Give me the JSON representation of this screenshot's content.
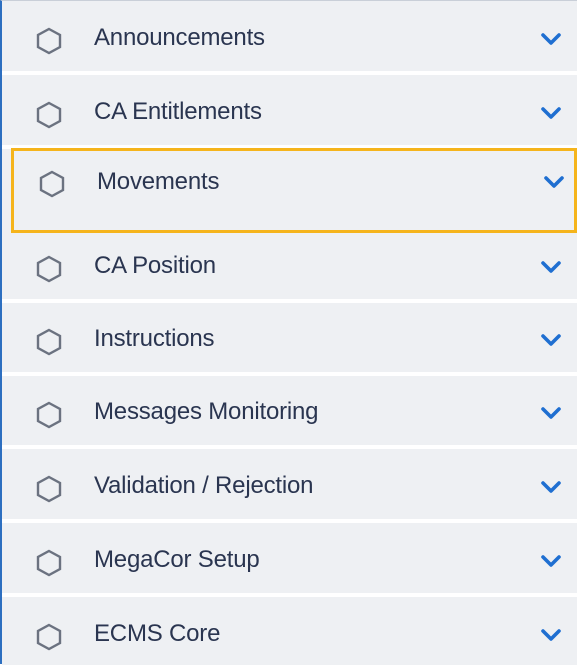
{
  "menu": {
    "items": [
      {
        "label": "Announcements",
        "icon": "hexagon-icon",
        "chevron": "chevron-down-icon"
      },
      {
        "label": "CA Entitlements",
        "icon": "hexagon-icon",
        "chevron": "chevron-down-icon"
      },
      {
        "label": "Movements",
        "icon": "hexagon-icon",
        "chevron": "chevron-down-icon",
        "selected": true
      },
      {
        "label": "CA Position",
        "icon": "hexagon-icon",
        "chevron": "chevron-down-icon"
      },
      {
        "label": "Instructions",
        "icon": "hexagon-icon",
        "chevron": "chevron-down-icon"
      },
      {
        "label": "Messages Monitoring",
        "icon": "hexagon-icon",
        "chevron": "chevron-down-icon"
      },
      {
        "label": "Validation / Rejection",
        "icon": "hexagon-icon",
        "chevron": "chevron-down-icon"
      },
      {
        "label": "MegaCor Setup",
        "icon": "hexagon-icon",
        "chevron": "chevron-down-icon"
      },
      {
        "label": "ECMS Core",
        "icon": "hexagon-icon",
        "chevron": "chevron-down-icon"
      }
    ]
  },
  "colors": {
    "text": "#2a3550",
    "chevron": "#1f6fd1",
    "highlight": "#f5b41b",
    "icon_stroke": "#6b7280",
    "accent_border": "#2d6fc0"
  }
}
